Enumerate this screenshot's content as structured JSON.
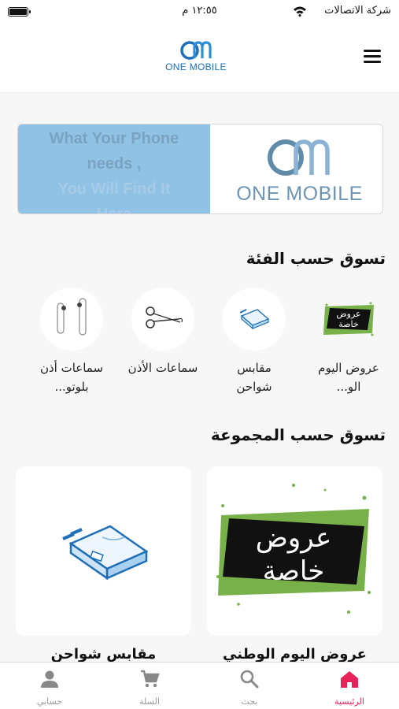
{
  "status_bar": {
    "carrier": "شركة الاتصالات",
    "time": "١٢:٥٥ م"
  },
  "header": {
    "logo_text": "ONE MOBILE",
    "logo_mark": "OM",
    "menu_icon": "hamburger-icon"
  },
  "banner": {
    "tagline": [
      "What Your Phone",
      "needs ,",
      "You Will Find It",
      "Here"
    ],
    "logo_text": "ONE MOBILE",
    "logo_mark": "OM"
  },
  "sections": {
    "categories_title": "تسوق حسب الفئة",
    "groups_title": "تسوق حسب المجموعة"
  },
  "categories": [
    {
      "label": "عروض اليوم الو...",
      "image_text": "عروض خاصة",
      "icon": "special-offers-icon"
    },
    {
      "label": "مقابس شواحن",
      "icon": "charger-icon"
    },
    {
      "label": "سماعات الأذن",
      "icon": "earphones-icon"
    },
    {
      "label": "سماعات أذن بلوتو...",
      "icon": "airpods-icon"
    }
  ],
  "groups": [
    {
      "label": "عروض اليوم الوطني",
      "image_text": "عروض خاصة",
      "icon": "special-offers-icon"
    },
    {
      "label": "مقابس شواحن",
      "icon": "charger-icon"
    }
  ],
  "tabs": [
    {
      "label": "الرئيسية",
      "icon": "home-icon",
      "active": true
    },
    {
      "label": "بحث",
      "icon": "search-icon",
      "active": false
    },
    {
      "label": "السلة",
      "icon": "cart-icon",
      "active": false
    },
    {
      "label": "حسابي",
      "icon": "user-icon",
      "active": false
    }
  ],
  "colors": {
    "accent": "#e8235a",
    "brand_blue": "#1e6fb8",
    "banner_blue": "#90c2e6",
    "offer_green": "#78b14a"
  }
}
